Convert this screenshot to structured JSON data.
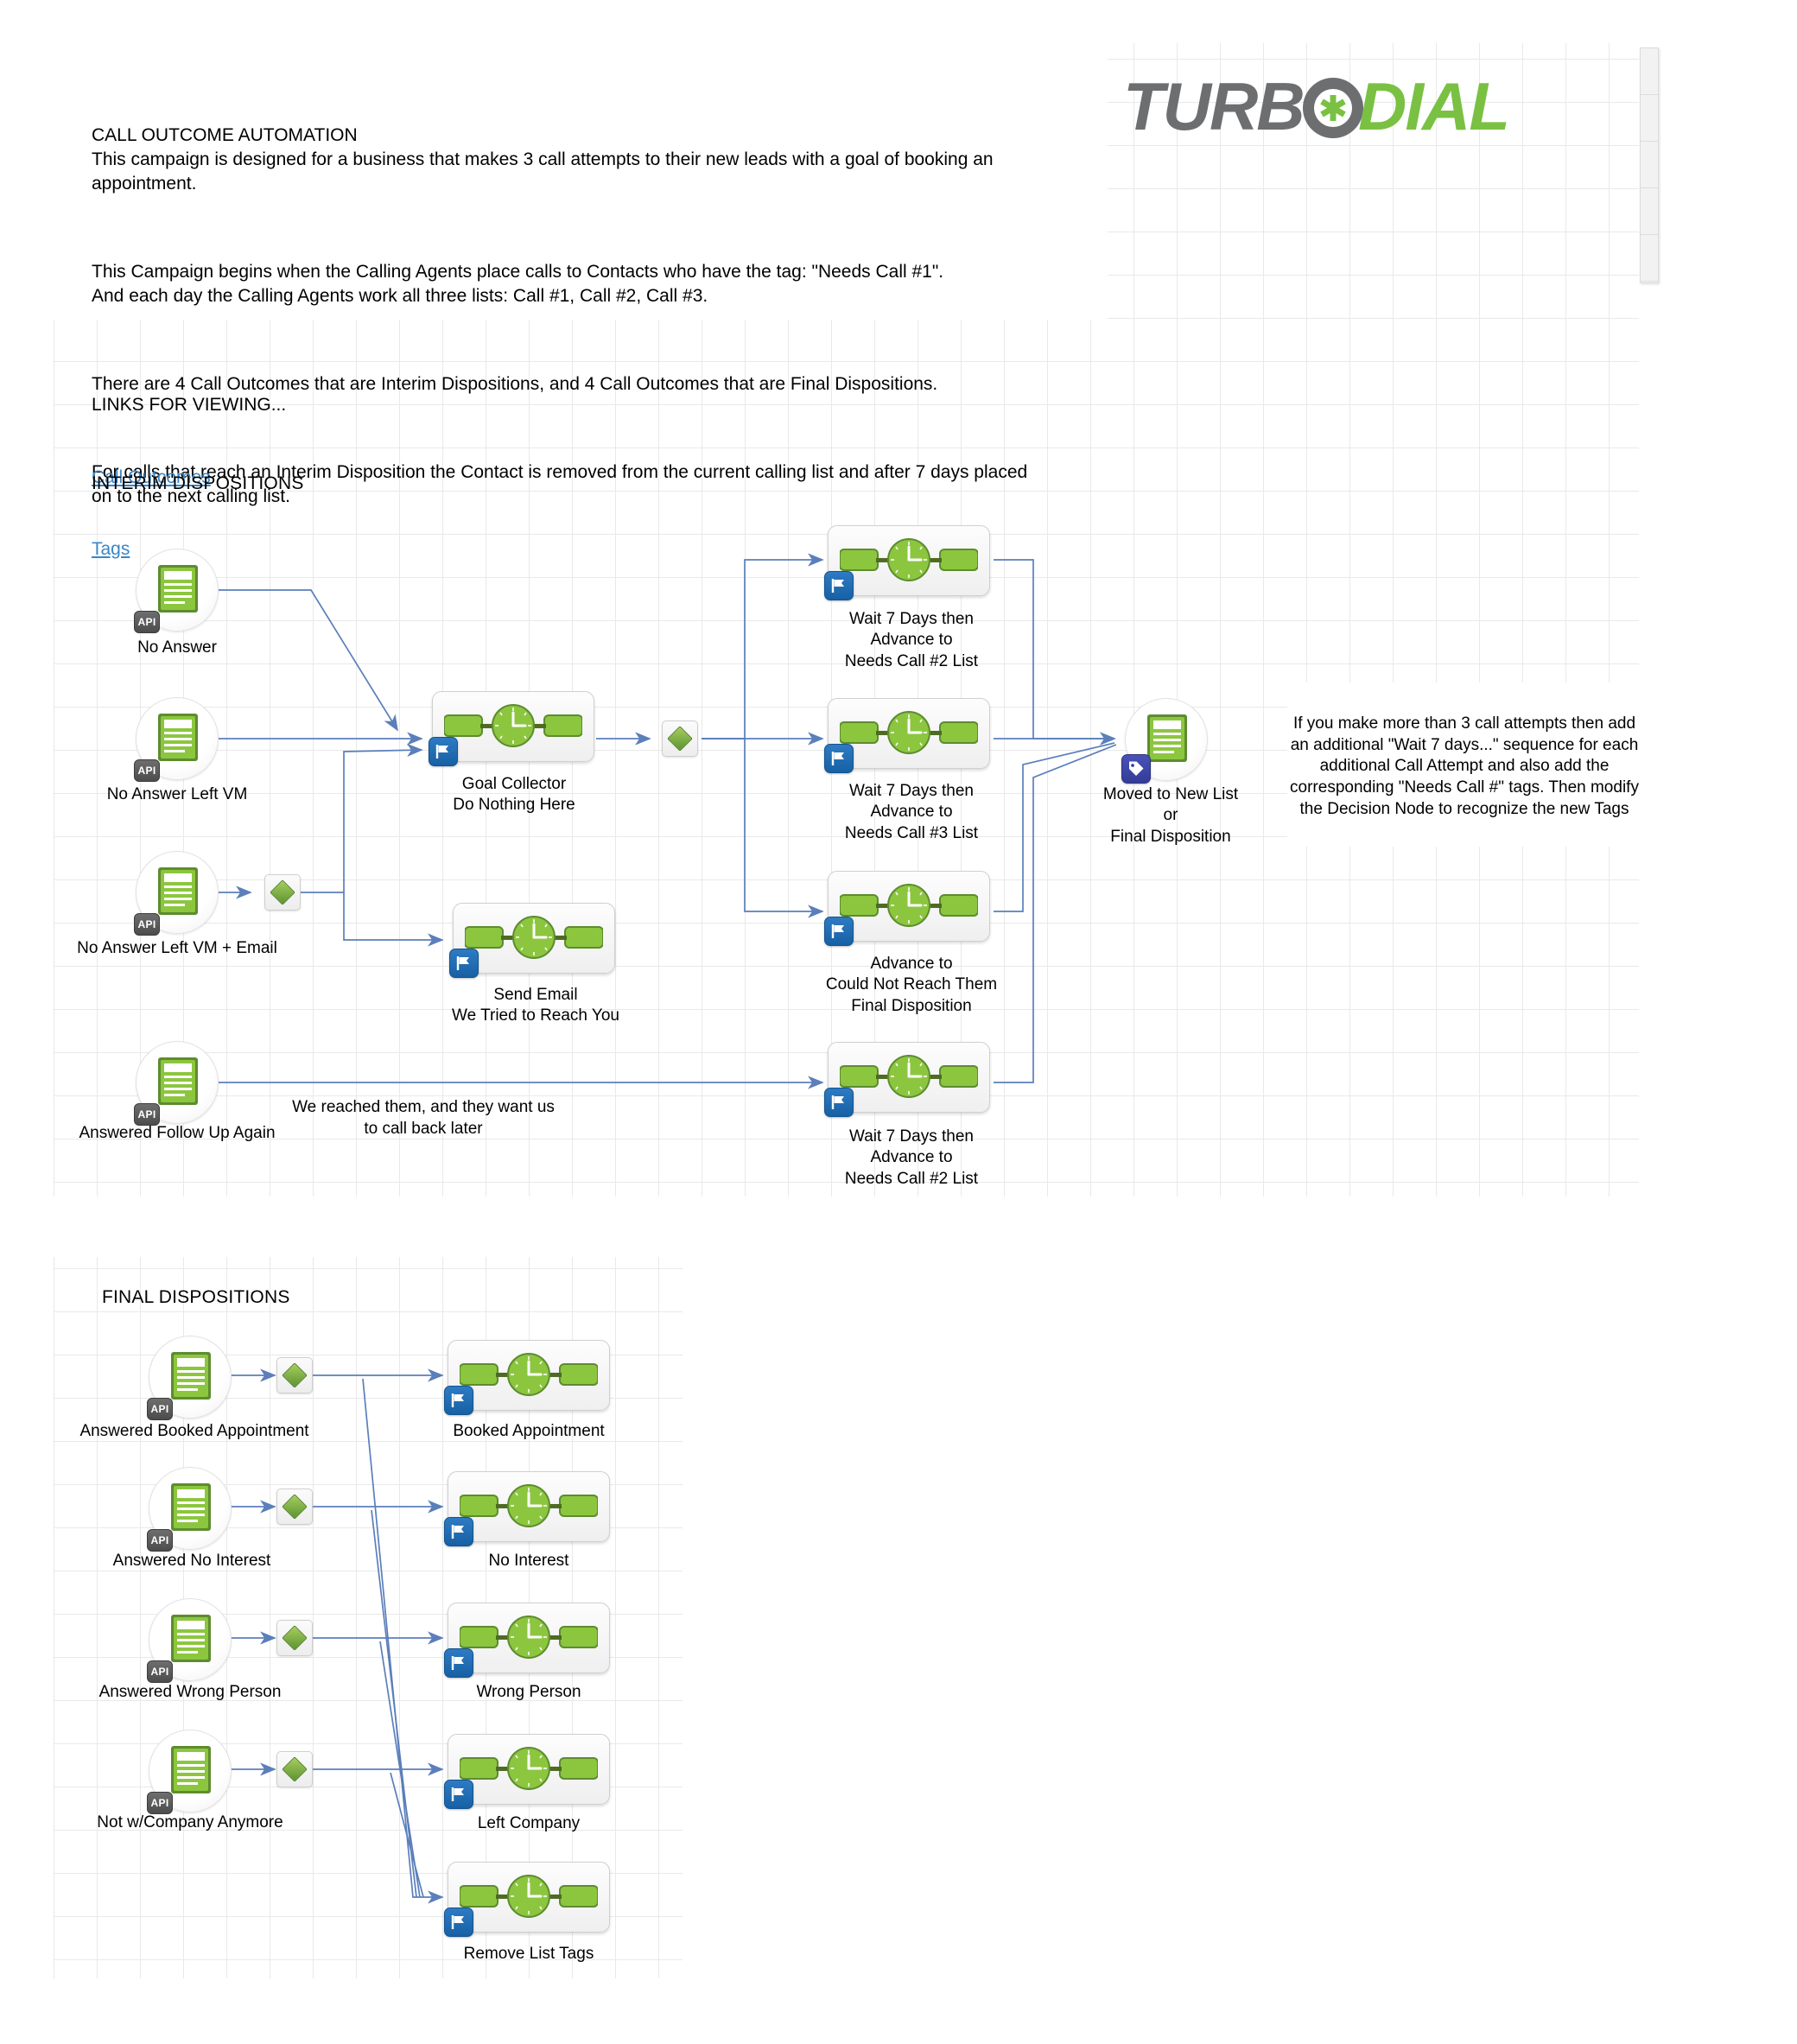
{
  "header": {
    "logo_text_primary": "TURBO",
    "logo_text_secondary": "DIAL",
    "logo_color_primary": "#6d6e70",
    "logo_color_secondary": "#7ac143"
  },
  "intro": {
    "title": "CALL OUTCOME AUTOMATION",
    "paragraphs": [
      "CALL OUTCOME AUTOMATION\nThis campaign is designed for a business that makes 3 call attempts to their new leads with a goal of booking an appointment.",
      "This Campaign begins when the Calling Agents place calls to Contacts who have the tag: \"Needs Call #1\".\nAnd each day the Calling Agents work all three lists: Call #1, Call #2, Call #3.",
      "There are 4 Call Outcomes that are Interim Dispositions, and 4 Call Outcomes that are Final Dispositions.",
      "For calls that reach an Interim Disposition the Contact is removed from the current calling list and after 7 days placed on to the next calling list."
    ]
  },
  "links": {
    "heading": "LINKS FOR VIEWING...",
    "items": [
      {
        "label": "Call Outcomes"
      },
      {
        "label": "Tags"
      }
    ],
    "link_color": "#3a86c8"
  },
  "sections": {
    "interim_title": "INTERIM DISPOSITIONS",
    "final_title": "FINAL DISPOSITIONS"
  },
  "notes": {
    "right_note": "If you make more than 3 call attempts then add an additional \"Wait 7 days...\" sequence for each additional Call Attempt and also add the corresponding \"Needs Call #\" tags.\nThen modify the Decision Node to recognize the new Tags",
    "reach_note": "We reached them, and they want us to call back later"
  },
  "interim": {
    "api_nodes": [
      {
        "id": "no-answer",
        "label": "No Answer",
        "badge": "API"
      },
      {
        "id": "no-answer-left-vm",
        "label": "No Answer Left VM",
        "badge": "API"
      },
      {
        "id": "no-answer-left-vm-email",
        "label": "No Answer Left VM + Email",
        "badge": "API"
      },
      {
        "id": "answered-follow-up-again",
        "label": "Answered Follow Up Again",
        "badge": "API"
      }
    ],
    "sequences": [
      {
        "id": "goal-collector",
        "label": "Goal Collector\nDo Nothing Here",
        "badge": "flag-icon"
      },
      {
        "id": "send-email",
        "label": "Send Email\nWe Tried to Reach You",
        "badge": "flag-icon"
      },
      {
        "id": "wait-call2-top",
        "label": "Wait 7 Days then\nAdvance to\nNeeds Call #2 List",
        "badge": "flag-icon"
      },
      {
        "id": "wait-call3",
        "label": "Wait 7 Days then\nAdvance to\nNeeds Call #3 List",
        "badge": "flag-icon"
      },
      {
        "id": "could-not-reach",
        "label": "Advance to\nCould Not Reach Them\nFinal Disposition",
        "badge": "flag-icon"
      },
      {
        "id": "wait-call2-bottom",
        "label": "Wait 7 Days then\nAdvance to\nNeeds Call #2 List",
        "badge": "flag-icon"
      }
    ],
    "end_node": {
      "id": "moved-to-new-list",
      "label": "Moved to New List\nor\nFinal Disposition",
      "badge": "tag-icon"
    }
  },
  "final": {
    "api_nodes": [
      {
        "id": "answered-booked-appointment",
        "label": "Answered Booked Appointment",
        "badge": "API"
      },
      {
        "id": "answered-no-interest",
        "label": "Answered No Interest",
        "badge": "API"
      },
      {
        "id": "answered-wrong-person",
        "label": "Answered Wrong Person",
        "badge": "API"
      },
      {
        "id": "not-w-company-anymore",
        "label": "Not w/Company Anymore",
        "badge": "API"
      }
    ],
    "sequences": [
      {
        "id": "booked-appointment",
        "label": "Booked Appointment",
        "badge": "flag-icon"
      },
      {
        "id": "no-interest",
        "label": "No Interest",
        "badge": "flag-icon"
      },
      {
        "id": "wrong-person",
        "label": "Wrong Person",
        "badge": "flag-icon"
      },
      {
        "id": "left-company",
        "label": "Left Company",
        "badge": "flag-icon"
      },
      {
        "id": "remove-list-tags",
        "label": "Remove List Tags",
        "badge": "flag-icon"
      }
    ]
  },
  "colors": {
    "edge": "#5b7fbb",
    "grid": "#e9e9e9",
    "green_light": "#a6ce5e",
    "green_dark": "#4f7f29"
  }
}
